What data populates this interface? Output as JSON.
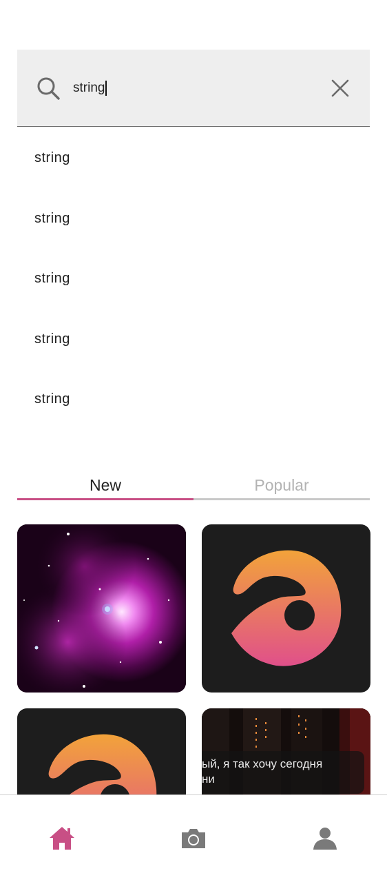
{
  "search": {
    "query": "string"
  },
  "suggestions": [
    "string",
    "string",
    "string",
    "string",
    "string"
  ],
  "tabs": [
    {
      "label": "New",
      "active": true
    },
    {
      "label": "Popular",
      "active": false
    }
  ],
  "feed": [
    {
      "kind": "image",
      "subject": "nebula"
    },
    {
      "kind": "image",
      "subject": "app-logo"
    },
    {
      "kind": "image",
      "subject": "app-logo"
    },
    {
      "kind": "video",
      "caption": "ый, я так хочу сегодня\nни"
    }
  ],
  "nav": [
    {
      "icon": "home-icon",
      "active": true
    },
    {
      "icon": "camera-icon",
      "active": false
    },
    {
      "icon": "profile-icon",
      "active": false
    }
  ],
  "colors": {
    "accent": "#c84f85",
    "search_bg": "#eeeeee",
    "inactive_icon": "#7a7a7a",
    "logo_gradient_top": "#f2a33a",
    "logo_gradient_bottom": "#e0508a",
    "tile_dark": "#1d1d1d"
  }
}
